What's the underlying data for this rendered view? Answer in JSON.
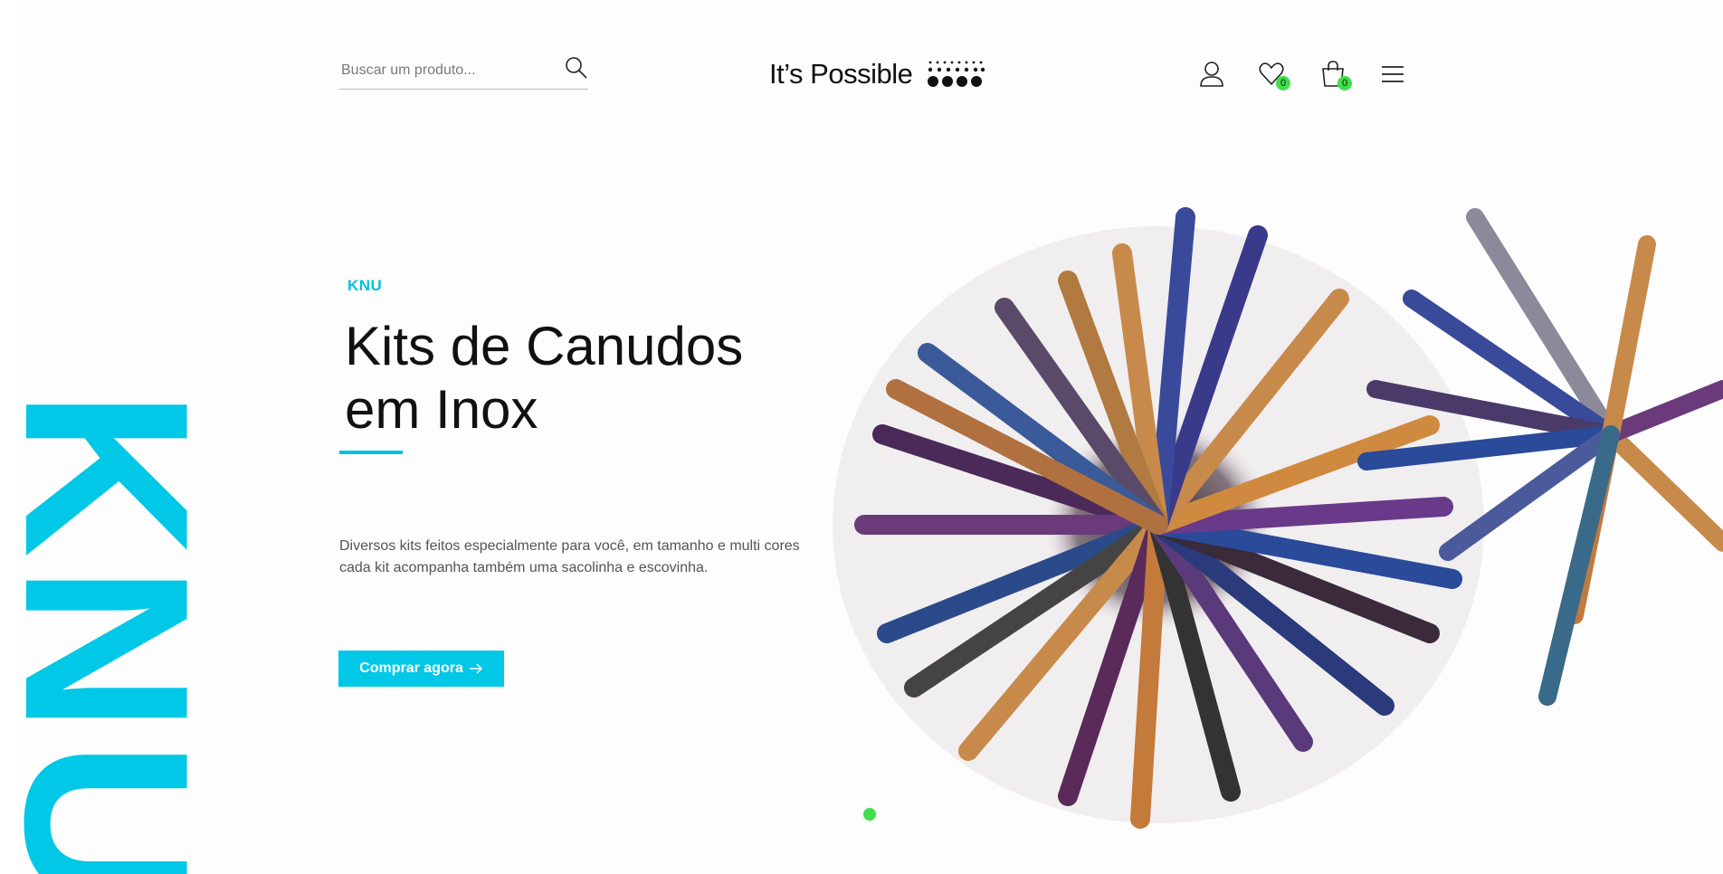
{
  "header": {
    "search": {
      "placeholder": "Buscar um produto...",
      "icon": "search-icon"
    },
    "logo": {
      "text": "It’s Possible"
    },
    "icons": [
      {
        "name": "user-icon"
      },
      {
        "name": "heart-icon",
        "count": "0"
      },
      {
        "name": "shopping-bag-icon",
        "count": "0"
      },
      {
        "name": "menu-icon"
      }
    ]
  },
  "hero": {
    "vertical_text": "KNU",
    "brand_tag": "KNU",
    "title_line1": "Kits de Canudos",
    "title_line2": "em Inox",
    "description_line1": "Diversos kits feitos especialmente para você, em tamanho e multi cores",
    "description_line2": "cada kit acompanha também uma sacolinha e escovinha.",
    "cta_label": "Comprar agora",
    "cta_icon": "arrow-right-icon",
    "accent_color": "#00c8e6",
    "badge_color": "#3ee04a",
    "slider_active": 1,
    "slider_total": 1,
    "image": "metal-straws-image"
  }
}
